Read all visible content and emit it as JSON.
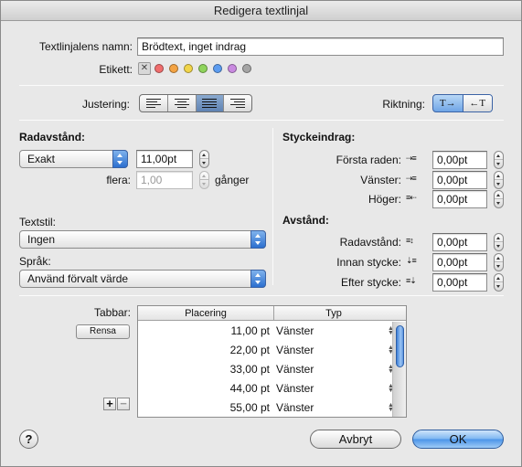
{
  "window": {
    "title": "Redigera textlinjal"
  },
  "name_row": {
    "label": "Textlinjalens namn:",
    "value": "Brödtext, inget indrag"
  },
  "label_row": {
    "label": "Etikett:",
    "none_glyph": "✕",
    "colors": [
      "#f06d6d",
      "#f4a343",
      "#f1d54a",
      "#8fd45c",
      "#5c9cf0",
      "#c98ae0",
      "#a5a5a5"
    ]
  },
  "alignment": {
    "label": "Justering:",
    "options": [
      "left",
      "center",
      "justify",
      "right"
    ],
    "selected": "justify"
  },
  "direction": {
    "label": "Riktning:",
    "ltr_glyph": "T→",
    "rtl_glyph": "←T"
  },
  "line_spacing": {
    "heading": "Radavstånd:",
    "mode": "Exakt",
    "value": "11,00pt",
    "multiple_label": "flera:",
    "multiple_value": "1,00",
    "multiple_unit": "gånger"
  },
  "text_style": {
    "label": "Textstil:",
    "value": "Ingen"
  },
  "language": {
    "label": "Språk:",
    "value": "Använd förvalt värde"
  },
  "indent": {
    "heading": "Styckeindrag:",
    "first_line": {
      "label": "Första raden:",
      "value": "0,00pt"
    },
    "left": {
      "label": "Vänster:",
      "value": "0,00pt"
    },
    "right": {
      "label": "Höger:",
      "value": "0,00pt"
    }
  },
  "spacing": {
    "heading": "Avstånd:",
    "line": {
      "label": "Radavstånd:",
      "value": "0,00pt"
    },
    "before": {
      "label": "Innan stycke:",
      "value": "0,00pt"
    },
    "after": {
      "label": "Efter stycke:",
      "value": "0,00pt"
    }
  },
  "tabs": {
    "label": "Tabbar:",
    "clear_button": "Rensa",
    "columns": [
      "Placering",
      "Typ"
    ],
    "rows": [
      {
        "position": "11,00 pt",
        "type": "Vänster"
      },
      {
        "position": "22,00 pt",
        "type": "Vänster"
      },
      {
        "position": "33,00 pt",
        "type": "Vänster"
      },
      {
        "position": "44,00 pt",
        "type": "Vänster"
      },
      {
        "position": "55,00 pt",
        "type": "Vänster"
      }
    ],
    "add_glyph": "+",
    "remove_glyph": "−"
  },
  "footer": {
    "help_glyph": "?",
    "cancel_label": "Avbryt",
    "ok_label": "OK"
  }
}
